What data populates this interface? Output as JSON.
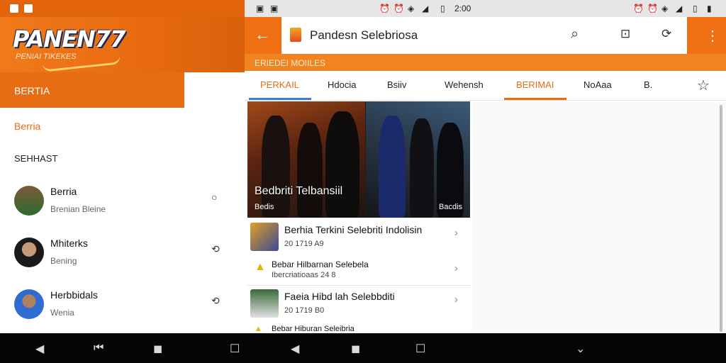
{
  "left": {
    "logo": "PANEN77",
    "logo_sub": "PENIAI TIKEKES",
    "menu_selected": "BERTIA",
    "menu_item": "Berria",
    "section_label": "SEHHAST",
    "chats": [
      {
        "name": "Berria",
        "sub": "Brenian Bleine",
        "action_icon": "circle-icon"
      },
      {
        "name": "Mhiterks",
        "sub": "Bening",
        "action_icon": "share-icon"
      },
      {
        "name": "Herbbidals",
        "sub": "Wenia",
        "action_icon": "share-icon"
      }
    ]
  },
  "right": {
    "status_time": "2:00",
    "search_text": "Pandesn Selebriosa",
    "subband": "ERIEDEI MOIILES",
    "tabs": [
      "PERKAIL",
      "Hdocia",
      "Bsiiv",
      "Wehensh",
      "BERIMAI",
      "NoAaa",
      "B."
    ],
    "hero": {
      "title": "Bedbriti Telbansiil",
      "left_tag": "Bedis",
      "right_tag": "Bacdis"
    },
    "news": [
      {
        "title": "Berhia Terkini Selebriti Indolisin",
        "meta": "20 1719  A9"
      },
      {
        "title": "Bebar Hilbarnan Selebela",
        "meta": "Ibercriatioaas 24  8"
      },
      {
        "title": "Faeia Hibd lah Selebbditi",
        "meta": "20 1719  B0"
      },
      {
        "title": "Bebar Hiburan Seleibria",
        "meta": ""
      }
    ]
  },
  "colors": {
    "accent": "#ef6f12",
    "accent_dark": "#e2650c"
  }
}
